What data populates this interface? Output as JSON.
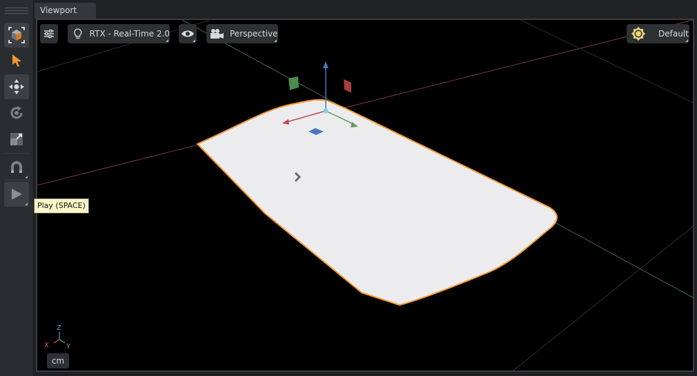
{
  "tab": {
    "title": "Viewport"
  },
  "toolbar": {
    "tools": [
      {
        "name": "select-mode",
        "icon": "cube-select-icon",
        "active": true
      },
      {
        "name": "select",
        "icon": "arrow-pointer-icon",
        "active": false
      },
      {
        "name": "move",
        "icon": "move-arrows-icon",
        "active": true
      },
      {
        "name": "rotate",
        "icon": "rotate-icon",
        "active": false
      },
      {
        "name": "scale",
        "icon": "scale-icon",
        "active": false
      },
      {
        "name": "snap",
        "icon": "magnet-icon",
        "active": false
      },
      {
        "name": "play",
        "icon": "play-icon",
        "active": false
      }
    ],
    "tooltip": "Play (SPACE)"
  },
  "viewport": {
    "settings_icon": "sliders-icon",
    "renderer": {
      "icon": "lightbulb-icon",
      "label": "RTX - Real-Time 2.0"
    },
    "visibility_icon": "eye-icon",
    "camera": {
      "icon": "camera-icon",
      "label": "Perspective"
    },
    "lighting": {
      "icon": "sun-icon",
      "label": "Default"
    },
    "axis_labels": {
      "z": "Z",
      "x": "X",
      "y": "Y"
    },
    "unit": "cm"
  },
  "colors": {
    "selection_outline": "#f0962a",
    "axis_x": "#c04a4a",
    "axis_y": "#5aa05a",
    "axis_z": "#4a78c0",
    "tooltip_bg": "#fbf6c9"
  }
}
